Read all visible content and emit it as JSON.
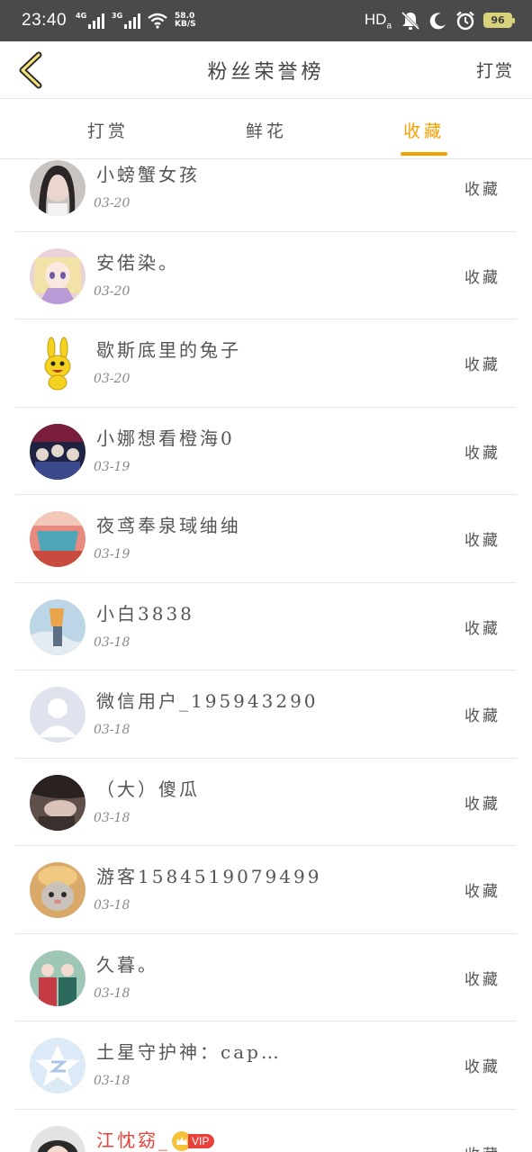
{
  "status_bar": {
    "time": "23:40",
    "net1": "4G",
    "net2": "3G",
    "speed_value": "58.0",
    "speed_unit": "KB/S",
    "hd": "HD",
    "battery": "96"
  },
  "nav": {
    "title": "粉丝荣誉榜",
    "action": "打赏"
  },
  "tabs": [
    {
      "label": "打赏",
      "active": false
    },
    {
      "label": "鲜花",
      "active": false
    },
    {
      "label": "收藏",
      "active": true
    }
  ],
  "list": [
    {
      "name": "小螃蟹女孩",
      "date": "03-20",
      "action": "收藏",
      "avatar": "girl-photo-avatar"
    },
    {
      "name": "安偌染。",
      "date": "03-20",
      "action": "收藏",
      "avatar": "anime-girl-avatar"
    },
    {
      "name": "歇斯底里的兔子",
      "date": "03-20",
      "action": "收藏",
      "avatar": "yellow-rabbit-avatar"
    },
    {
      "name": "小娜想看橙海0",
      "date": "03-19",
      "action": "收藏",
      "avatar": "concert-avatar"
    },
    {
      "name": "夜鸢奉泉琙䌷䌷",
      "date": "03-19",
      "action": "收藏",
      "avatar": "cartoon-avatar"
    },
    {
      "name": "小白3838",
      "date": "03-18",
      "action": "收藏",
      "avatar": "sky-avatar"
    },
    {
      "name": "微信用户_195943290",
      "date": "03-18",
      "action": "收藏",
      "avatar": "default-user-avatar"
    },
    {
      "name": "（大）傻瓜",
      "date": "03-18",
      "action": "收藏",
      "avatar": "dark-photo-avatar"
    },
    {
      "name": "游客1584519079499",
      "date": "03-18",
      "action": "收藏",
      "avatar": "cat-avatar"
    },
    {
      "name": "久暮。",
      "date": "03-18",
      "action": "收藏",
      "avatar": "costume-avatar"
    },
    {
      "name": "土星守护神：cap…",
      "date": "03-18",
      "action": "收藏",
      "avatar": "qq-default-avatar"
    },
    {
      "name": "江忱窈_",
      "date": "",
      "action": "收藏",
      "avatar": "glasses-avatar",
      "vip": "VIP"
    }
  ],
  "colors": {
    "accent": "#f2a100",
    "vip_red": "#e8413a",
    "status_bar_bg": "#4a4a4a"
  }
}
